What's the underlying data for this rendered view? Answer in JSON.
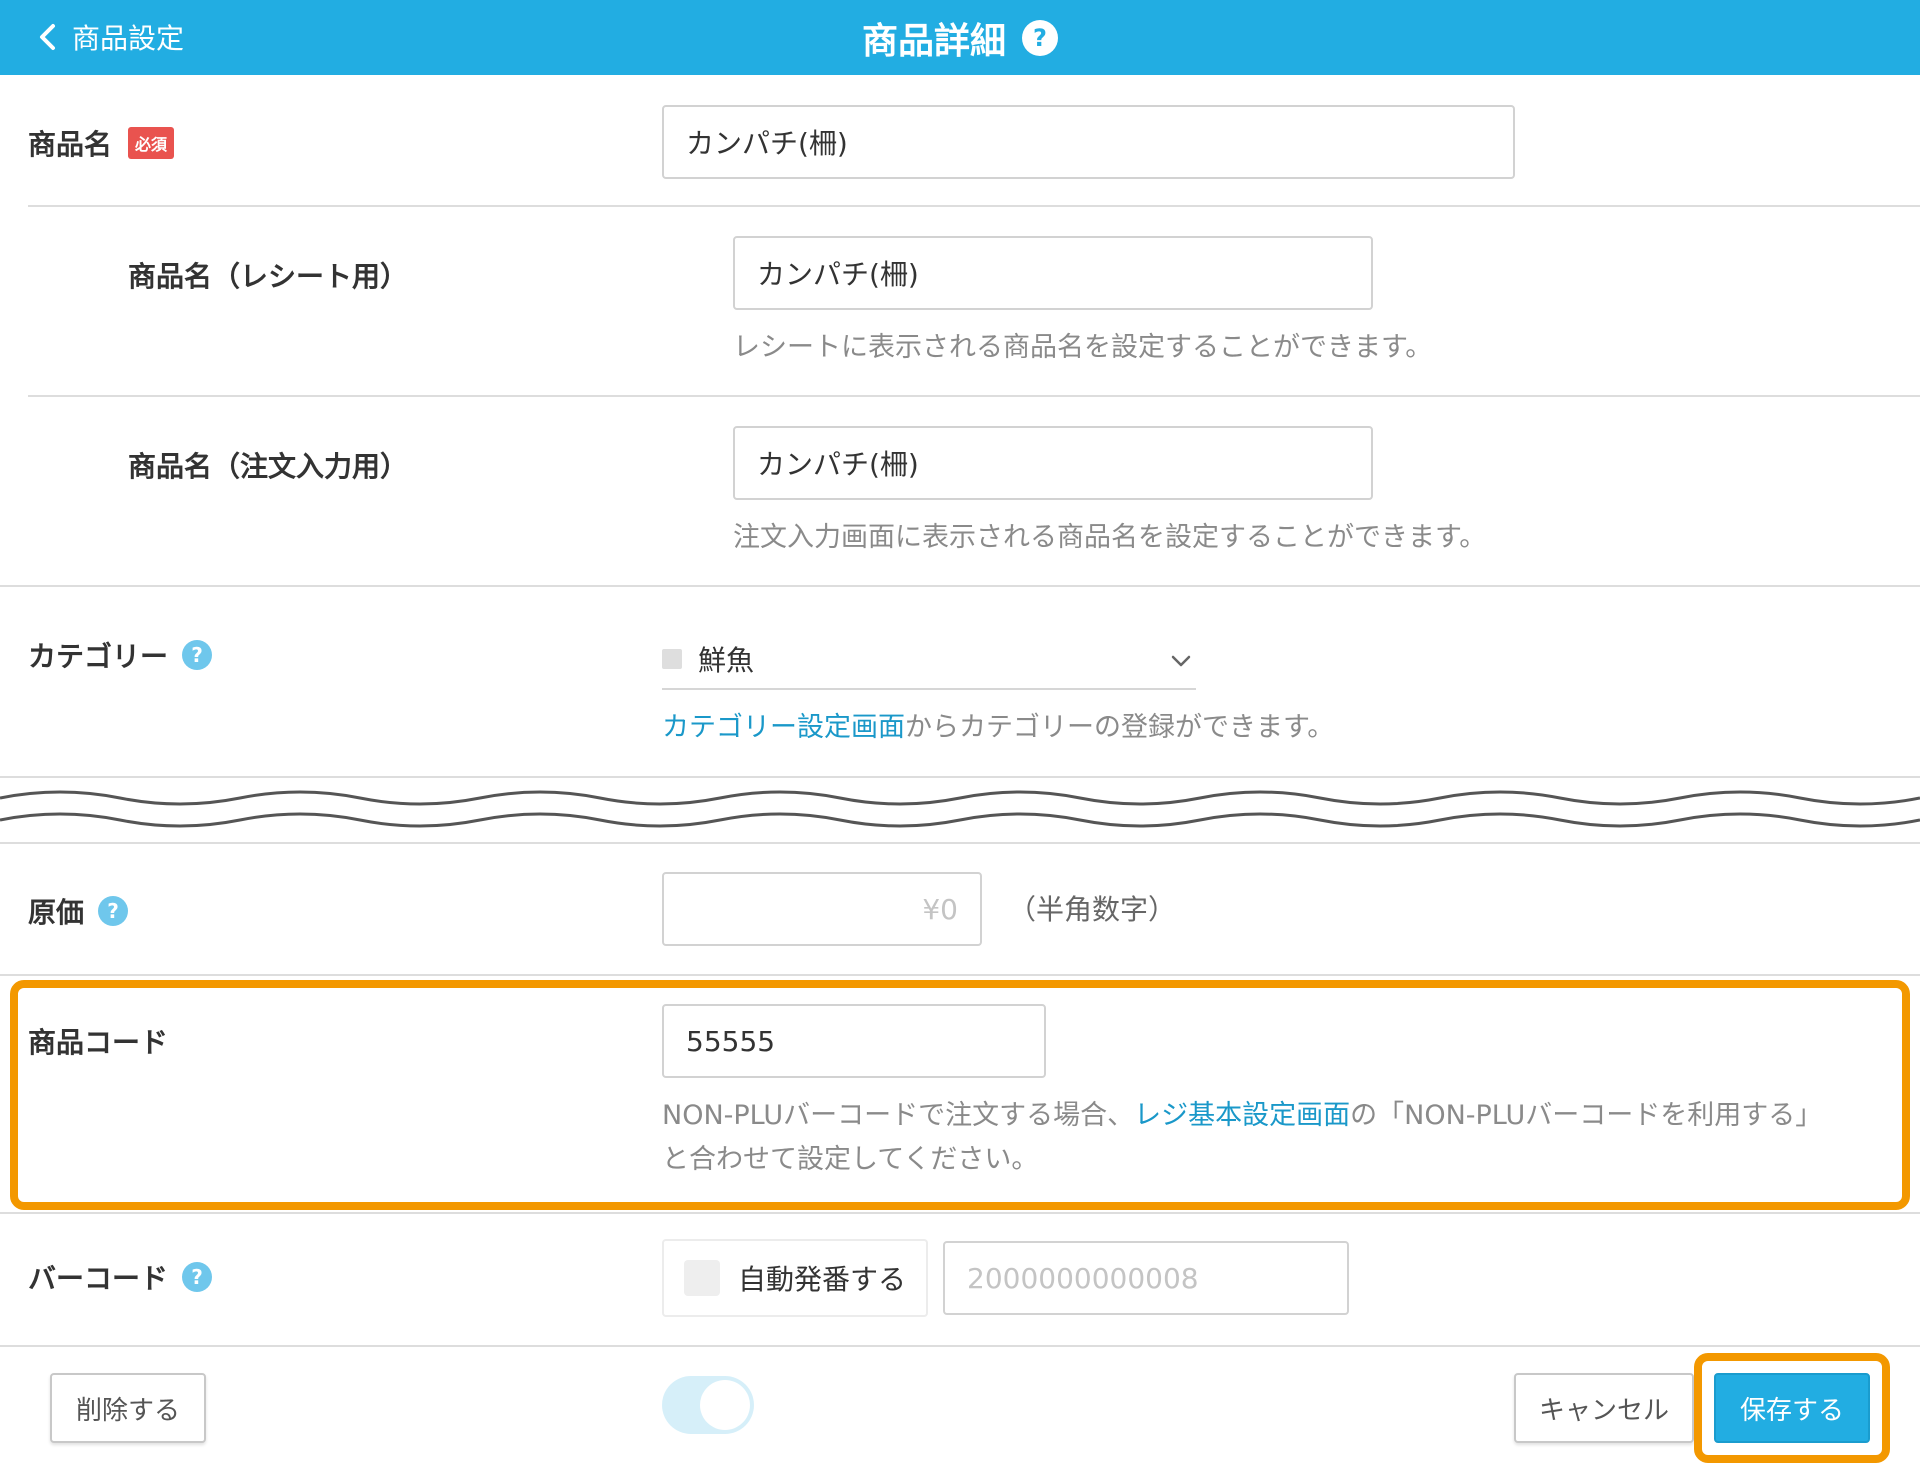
{
  "header": {
    "back_label": "商品設定",
    "title": "商品詳細",
    "help": "?",
    "color": "#22ade2"
  },
  "form": {
    "product_name": {
      "label": "商品名",
      "required_badge": "必須",
      "value": "カンパチ(柵)"
    },
    "receipt_name": {
      "label": "商品名（レシート用）",
      "value": "カンパチ(柵)",
      "hint": "レシートに表示される商品名を設定することができます。"
    },
    "order_name": {
      "label": "商品名（注文入力用）",
      "value": "カンパチ(柵)",
      "hint": "注文入力画面に表示される商品名を設定することができます。"
    },
    "category": {
      "label": "カテゴリー",
      "help": "?",
      "selected": "鮮魚",
      "hint_link": "カテゴリー設定画面",
      "hint_rest": "からカテゴリーの登録ができます。"
    },
    "cost": {
      "label": "原価",
      "help": "?",
      "placeholder": "¥0",
      "suffix": "（半角数字）"
    },
    "product_code": {
      "label": "商品コード",
      "value": "55555",
      "hint_pre": "NON-PLUバーコードで注文する場合、",
      "hint_link": "レジ基本設定画面",
      "hint_post": "の「NON-PLUバーコードを利用する」",
      "hint_line2": "と合わせて設定してください。"
    },
    "barcode": {
      "label": "バーコード",
      "help": "?",
      "auto_label": "自動発番する",
      "placeholder": "2000000000008"
    }
  },
  "actions": {
    "delete_label": "削除する",
    "cancel_label": "キャンセル",
    "save_label": "保存する"
  },
  "highlight_color": "#f39800"
}
